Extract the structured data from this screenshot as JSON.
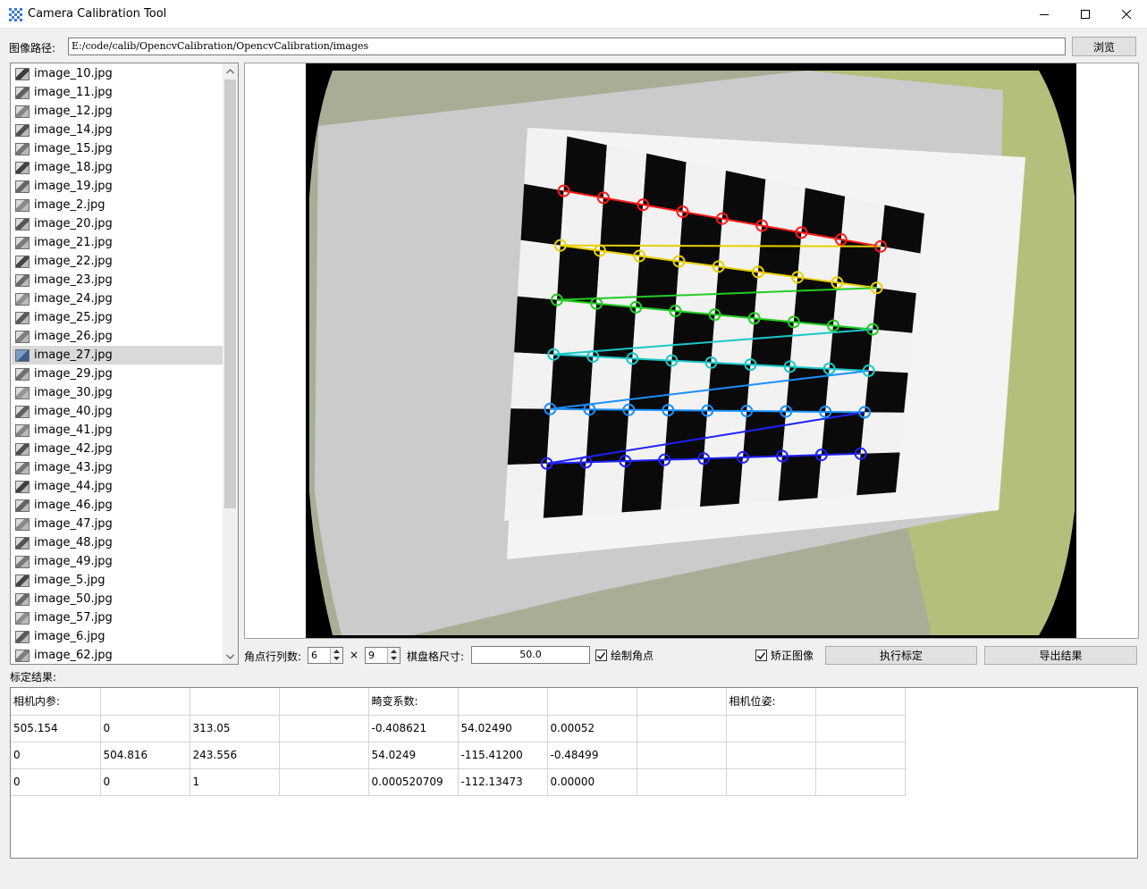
{
  "window": {
    "title": "Camera Calibration Tool",
    "controls": [
      "minimize",
      "maximize",
      "close"
    ]
  },
  "path_row": {
    "label": "图像路径:",
    "value": "E:/code/calib/OpencvCalibration/OpencvCalibration/images",
    "browse_label": "浏览"
  },
  "file_list": {
    "items": [
      "image_10.jpg",
      "image_11.jpg",
      "image_12.jpg",
      "image_14.jpg",
      "image_15.jpg",
      "image_18.jpg",
      "image_19.jpg",
      "image_2.jpg",
      "image_20.jpg",
      "image_21.jpg",
      "image_22.jpg",
      "image_23.jpg",
      "image_24.jpg",
      "image_25.jpg",
      "image_26.jpg",
      "image_27.jpg",
      "image_29.jpg",
      "image_30.jpg",
      "image_40.jpg",
      "image_41.jpg",
      "image_42.jpg",
      "image_43.jpg",
      "image_44.jpg",
      "image_46.jpg",
      "image_47.jpg",
      "image_48.jpg",
      "image_49.jpg",
      "image_5.jpg",
      "image_50.jpg",
      "image_57.jpg",
      "image_6.jpg",
      "image_62.jpg"
    ],
    "selected": "image_27.jpg"
  },
  "controls": {
    "corner_label": "角点行列数:",
    "rows": "6",
    "times": "×",
    "cols": "9",
    "square_size_label": "棋盘格尺寸:",
    "square_size": "50.0",
    "draw_corners_label": "绘制角点",
    "draw_corners_checked": true,
    "undistort_label": "矫正图像",
    "undistort_checked": true,
    "calibrate_label": "执行标定",
    "export_label": "导出结果"
  },
  "results": {
    "label": "标定结果:",
    "rows": [
      [
        "相机内参:",
        "",
        "",
        "",
        "畸变系数:",
        "",
        "",
        "",
        "相机位姿:",
        ""
      ],
      [
        "505.154",
        "0",
        "313.05",
        "",
        "-0.408621",
        "54.02490",
        "0.00052",
        "",
        "",
        ""
      ],
      [
        "0",
        "504.816",
        "243.556",
        "",
        "54.0249",
        "-115.41200",
        "-0.48499",
        "",
        "",
        ""
      ],
      [
        "0",
        "0",
        "1",
        "",
        "0.000520709",
        "-112.13473",
        "0.00000",
        "",
        "",
        ""
      ]
    ]
  },
  "colors": {
    "corner_rows": [
      "#ff1a1a",
      "#e8d000",
      "#22cc22",
      "#1ac8c8",
      "#1a8fff",
      "#2020ff"
    ],
    "selection": "#d9d9d9"
  }
}
